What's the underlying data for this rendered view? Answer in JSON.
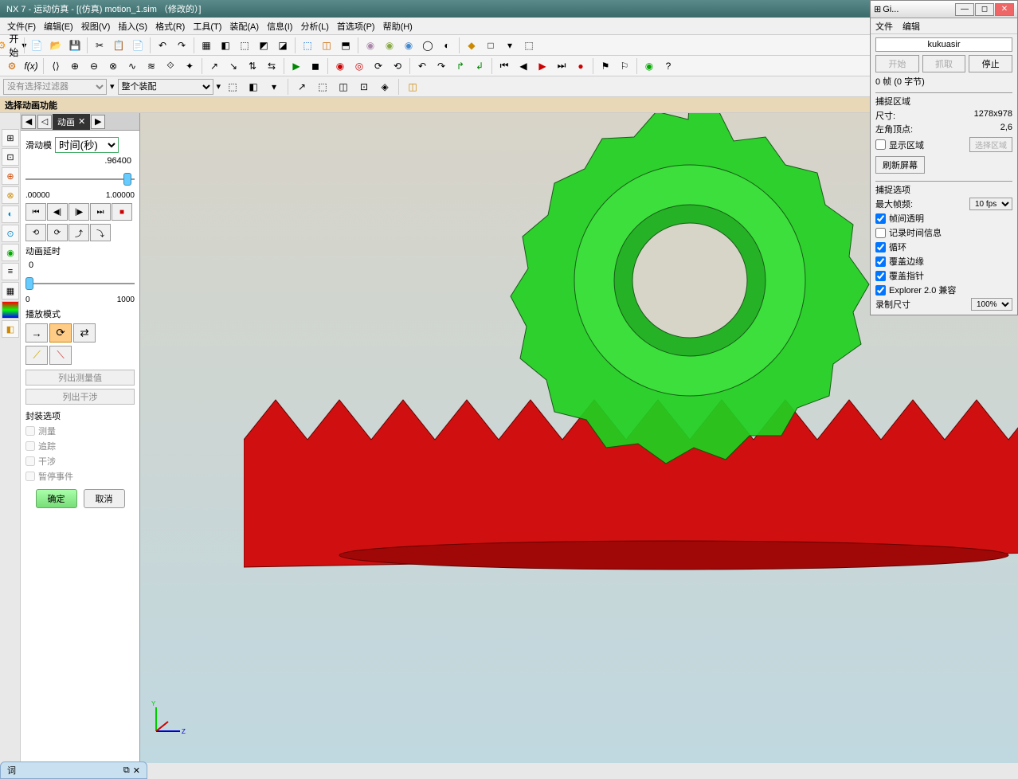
{
  "titlebar": "NX 7 - 运动仿真 - [(仿真) motion_1.sim （修改的）]",
  "menubar": [
    "文件(F)",
    "编辑(E)",
    "视图(V)",
    "插入(S)",
    "格式(R)",
    "工具(T)",
    "装配(A)",
    "信息(I)",
    "分析(L)",
    "首选项(P)",
    "帮助(H)"
  ],
  "start_button": "开始",
  "filter": {
    "placeholder": "没有选择过滤器",
    "assembly": "整个装配"
  },
  "status": "选择动画功能",
  "panel": {
    "tab": "动画",
    "slide_label": "滑动模",
    "slide_unit": "时间(秒)",
    "value": ".96400",
    "min": ".00000",
    "max": "1.00000",
    "delay_label": "动画延时",
    "delay_val": "0",
    "delay_min": "0",
    "delay_max": "1000",
    "mode_label": "播放模式",
    "btn_measure_list": "列出测量值",
    "btn_interference": "列出干涉",
    "pack_label": "封装选项",
    "checks": [
      "测量",
      "追踪",
      "干涉",
      "暂停事件"
    ],
    "ok": "确定",
    "cancel": "取消"
  },
  "gi": {
    "title": "Gi...",
    "menu": [
      "文件",
      "编辑"
    ],
    "name": "kukuasir",
    "btns": [
      "开始",
      "抓取",
      "停止"
    ],
    "frames": "0 帧 (0 字节)",
    "capture_area": "捕捉区域",
    "size_label": "尺寸:",
    "size_val": "1278x978",
    "corner_label": "左角顶点:",
    "corner_val": "2,6",
    "show_area": "显示区域",
    "select_area": "选择区域",
    "refresh": "刷新屏幕",
    "options_title": "捕捉选项",
    "max_fps_label": "最大帧频:",
    "max_fps_val": "10 fps",
    "opts": [
      "帧间透明",
      "记录时间信息",
      "循环",
      "覆盖边缘",
      "覆盖指针",
      "Explorer 2.0 兼容"
    ],
    "opts_checked": [
      true,
      false,
      true,
      true,
      true,
      true
    ],
    "rec_size_label": "录制尺寸",
    "rec_size_val": "100%"
  },
  "bottom_tab": "词"
}
